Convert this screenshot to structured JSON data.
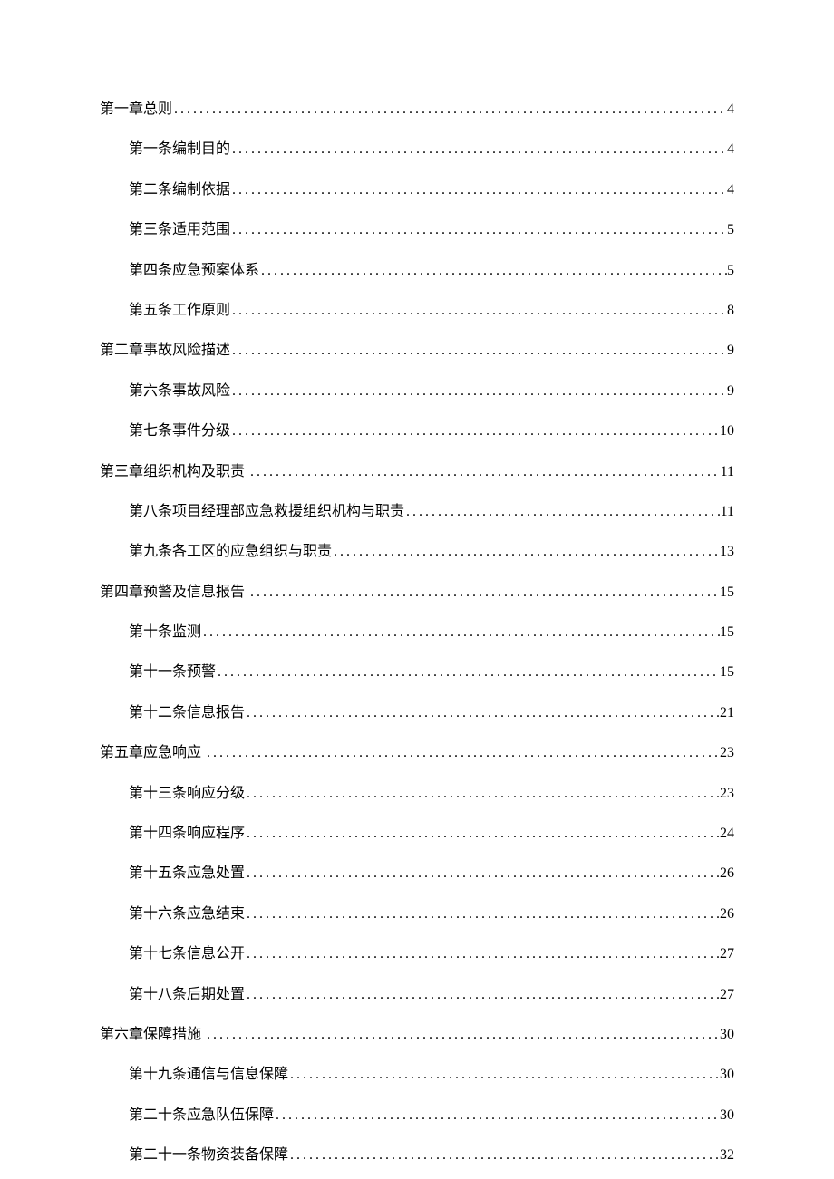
{
  "toc": [
    {
      "level": 1,
      "title": "第一章总则",
      "page": "4",
      "trailingSpace": false
    },
    {
      "level": 2,
      "title": "第一条编制目的",
      "page": "4",
      "trailingSpace": false
    },
    {
      "level": 2,
      "title": "第二条编制依据",
      "page": "4",
      "trailingSpace": false
    },
    {
      "level": 2,
      "title": "第三条适用范围",
      "page": "5",
      "trailingSpace": false
    },
    {
      "level": 2,
      "title": "第四条应急预案体系",
      "page": "5",
      "trailingSpace": false
    },
    {
      "level": 2,
      "title": "第五条工作原则",
      "page": "8",
      "trailingSpace": false
    },
    {
      "level": 1,
      "title": "第二章事故风险描述",
      "page": "9",
      "trailingSpace": false
    },
    {
      "level": 2,
      "title": "第六条事故风险",
      "page": "9",
      "trailingSpace": false
    },
    {
      "level": 2,
      "title": "第七条事件分级",
      "page": "10",
      "trailingSpace": false
    },
    {
      "level": 1,
      "title": "第三章组织机构及职责",
      "page": "11",
      "trailingSpace": true
    },
    {
      "level": 2,
      "title": "第八条项目经理部应急救援组织机构与职责",
      "page": "11",
      "trailingSpace": false
    },
    {
      "level": 2,
      "title": "第九条各工区的应急组织与职责",
      "page": "13",
      "trailingSpace": false
    },
    {
      "level": 1,
      "title": "第四章预警及信息报告",
      "page": "15",
      "trailingSpace": true
    },
    {
      "level": 2,
      "title": "第十条监测",
      "page": "15",
      "trailingSpace": false
    },
    {
      "level": 2,
      "title": "第十一条预警",
      "page": "15",
      "trailingSpace": false
    },
    {
      "level": 2,
      "title": "第十二条信息报告",
      "page": "21",
      "trailingSpace": false
    },
    {
      "level": 1,
      "title": "第五章应急响应",
      "page": "23",
      "trailingSpace": true
    },
    {
      "level": 2,
      "title": "第十三条响应分级",
      "page": "23",
      "trailingSpace": false
    },
    {
      "level": 2,
      "title": "第十四条响应程序",
      "page": "24",
      "trailingSpace": false
    },
    {
      "level": 2,
      "title": "第十五条应急处置",
      "page": "26",
      "trailingSpace": false
    },
    {
      "level": 2,
      "title": "第十六条应急结束",
      "page": "26",
      "trailingSpace": false
    },
    {
      "level": 2,
      "title": "第十七条信息公开",
      "page": "27",
      "trailingSpace": false
    },
    {
      "level": 2,
      "title": "第十八条后期处置",
      "page": "27",
      "trailingSpace": false
    },
    {
      "level": 1,
      "title": "第六章保障措施",
      "page": "30",
      "trailingSpace": true
    },
    {
      "level": 2,
      "title": "第十九条通信与信息保障",
      "page": "30",
      "trailingSpace": false
    },
    {
      "level": 2,
      "title": "第二十条应急队伍保障",
      "page": "30",
      "trailingSpace": false
    },
    {
      "level": 2,
      "title": "第二十一条物资装备保障",
      "page": "32",
      "trailingSpace": false
    }
  ]
}
